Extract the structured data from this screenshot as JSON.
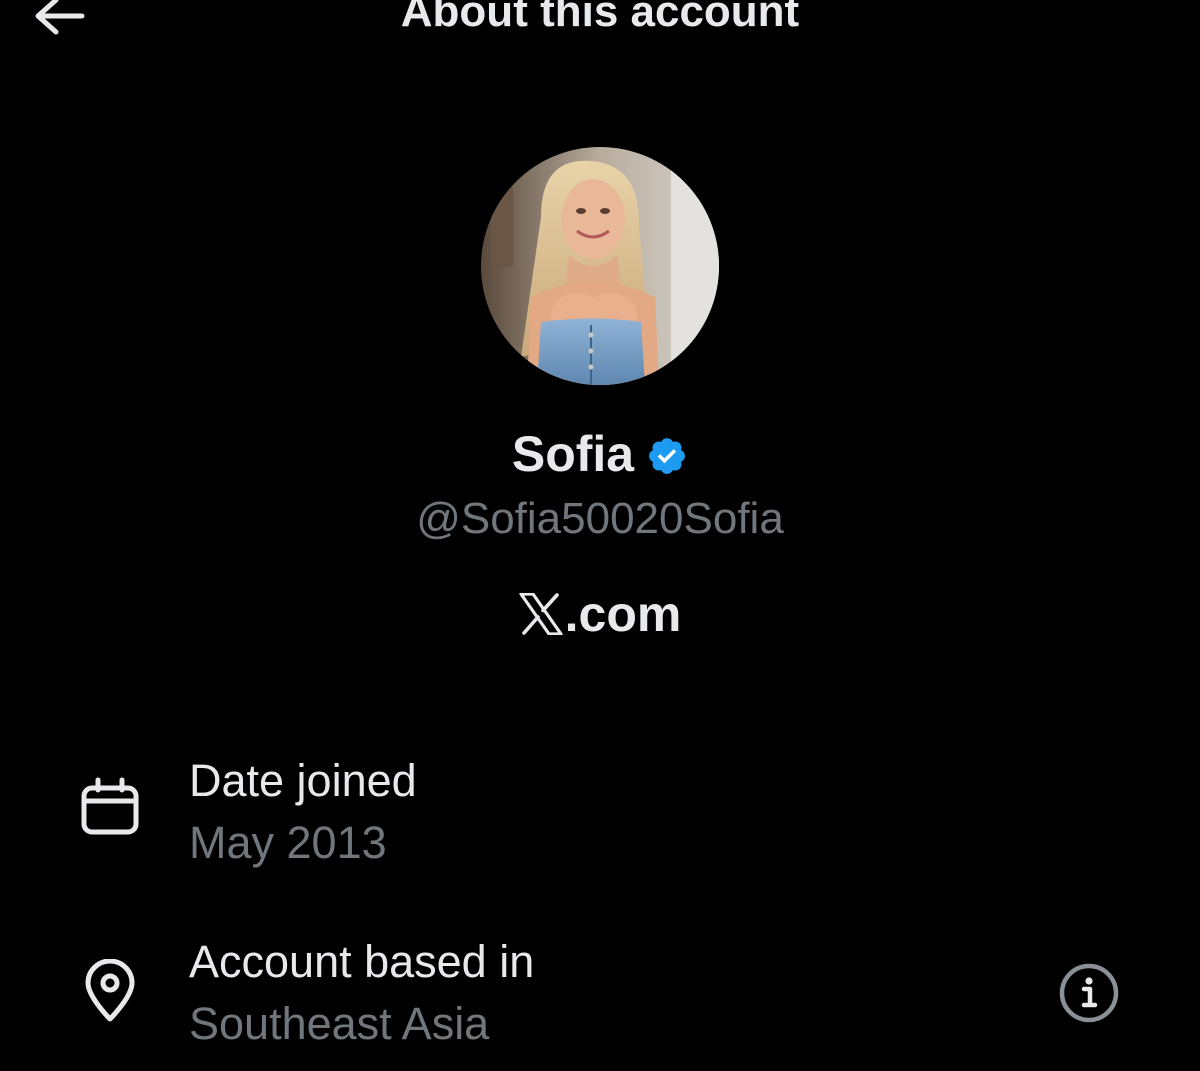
{
  "header": {
    "title": "About this account",
    "back_icon": "arrow-left-icon"
  },
  "profile": {
    "avatar_icon": "profile-photo",
    "display_name": "Sofia",
    "verified_icon": "verified-badge-icon",
    "verified_color": "#1d9bf0",
    "handle": "@Sofia50020Sofia",
    "brand_logo_icon": "x-logo-icon",
    "brand_suffix": ".com"
  },
  "details": [
    {
      "icon": "calendar-icon",
      "label": "Date joined",
      "value": "May 2013"
    },
    {
      "icon": "location-pin-icon",
      "label": "Account based in",
      "value": "Southeast Asia",
      "action_icon": "info-icon"
    }
  ],
  "colors": {
    "background": "#000000",
    "primary_text": "#e7e9ea",
    "secondary_text": "#71767b"
  }
}
